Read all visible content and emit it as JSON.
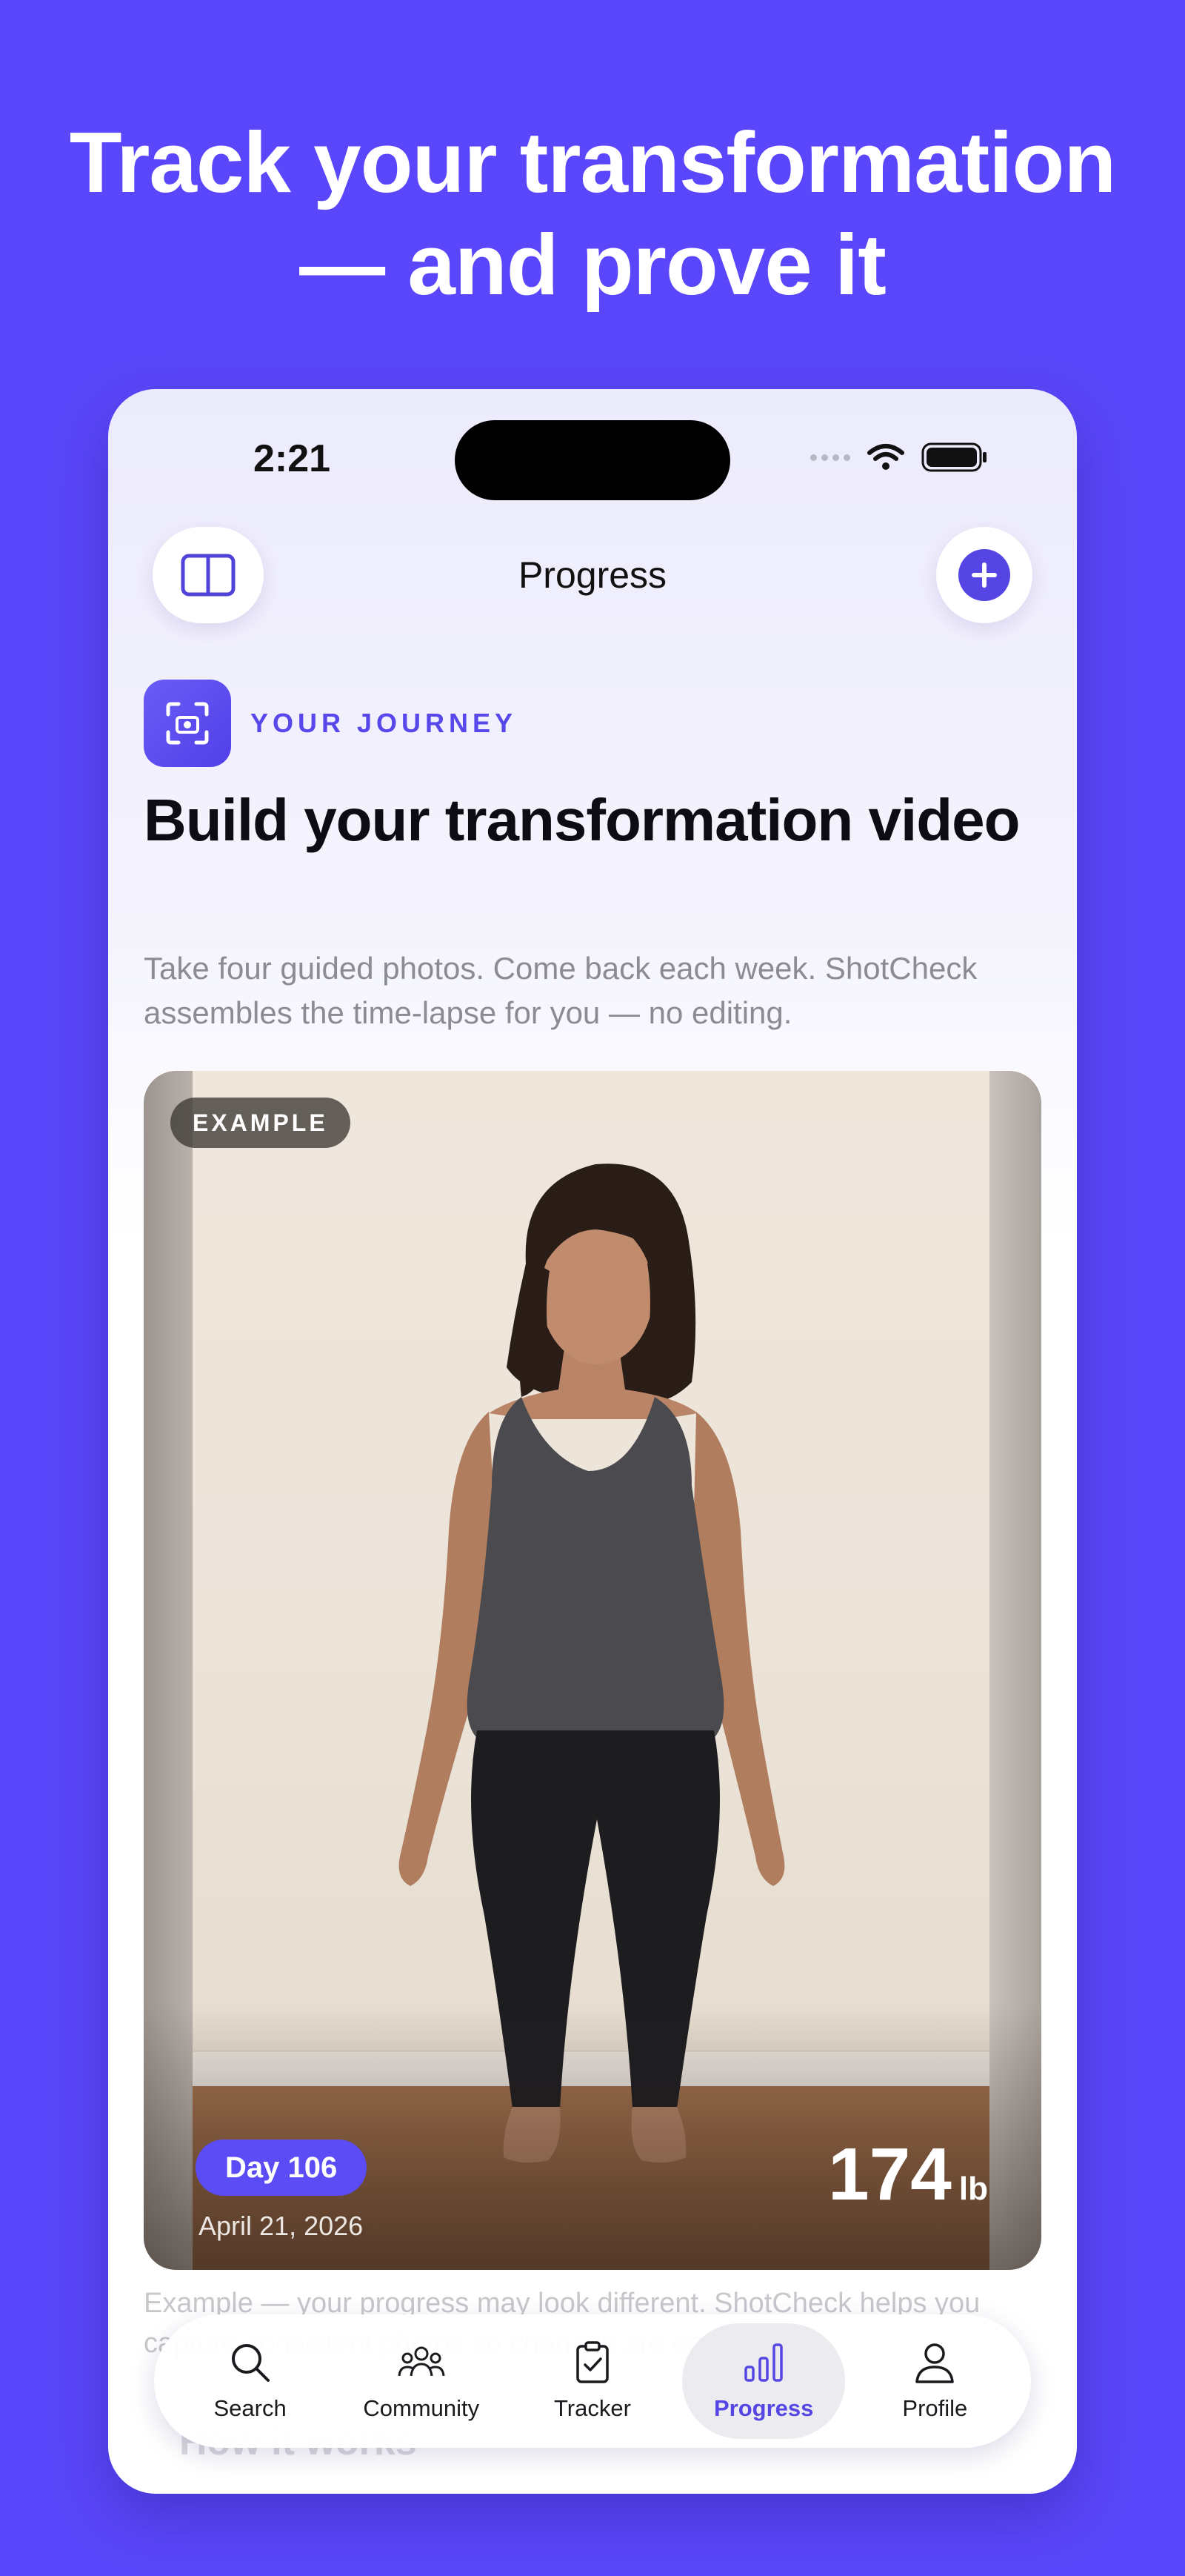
{
  "headline": {
    "line1": "Track your transformation",
    "line2": "— and prove it"
  },
  "status_bar": {
    "time": "2:21"
  },
  "nav": {
    "title": "Progress",
    "left_icon": "sidebar-icon",
    "right_icon": "plus-icon"
  },
  "hero": {
    "eyebrow": "YOUR JOURNEY",
    "title": "Build your transformation video",
    "subtitle": "Take four guided photos. Come back each week. ShotCheck assembles the time-lapse for you — no editing."
  },
  "example_card": {
    "badge": "EXAMPLE",
    "day": "Day 106",
    "date": "April 21, 2026",
    "weight_value": "174",
    "weight_unit": "lb"
  },
  "disclaimer": "Example — your progress may look different. ShotCheck helps you capture consistent photos so changes are easy to see.",
  "section_heading": "How it works",
  "tabs": [
    {
      "label": "Search",
      "icon": "search-icon"
    },
    {
      "label": "Community",
      "icon": "community-icon"
    },
    {
      "label": "Tracker",
      "icon": "clipboard-icon"
    },
    {
      "label": "Progress",
      "icon": "chart-icon",
      "active": true
    },
    {
      "label": "Profile",
      "icon": "profile-icon"
    }
  ],
  "colors": {
    "brand": "#5b47fb",
    "accent": "#5546e4"
  }
}
